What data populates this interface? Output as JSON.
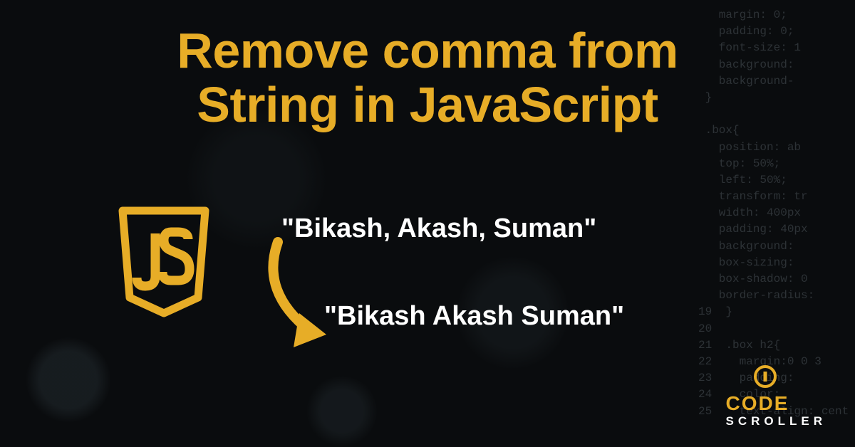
{
  "title_line1": "Remove comma from",
  "title_line2": "String in JavaScript",
  "example": {
    "before": "\"Bikash, Akash, Suman\"",
    "after": "\"Bikash Akash Suman\""
  },
  "brand": {
    "word1": "CODE",
    "word2": "SCROLLER"
  },
  "colors": {
    "accent": "#e7ad27",
    "bg": "#0a0c0e",
    "text": "#ffffff"
  },
  "bg_code_lines": "   margin: 0;\n   padding: 0;\n   font-size: 1\n   background:\n   background-\n }\n\n .box{\n   position: ab\n   top: 50%;\n   left: 50%;\n   transform: tr\n   width: 400px\n   padding: 40px\n   background:\n   box-sizing:\n   box-shadow: 0\n   border-radius:\n19  }\n20\n21  .box h2{\n22    margin:0 0 3\n23    padding:\n24    color:\n25    text-align: cent"
}
